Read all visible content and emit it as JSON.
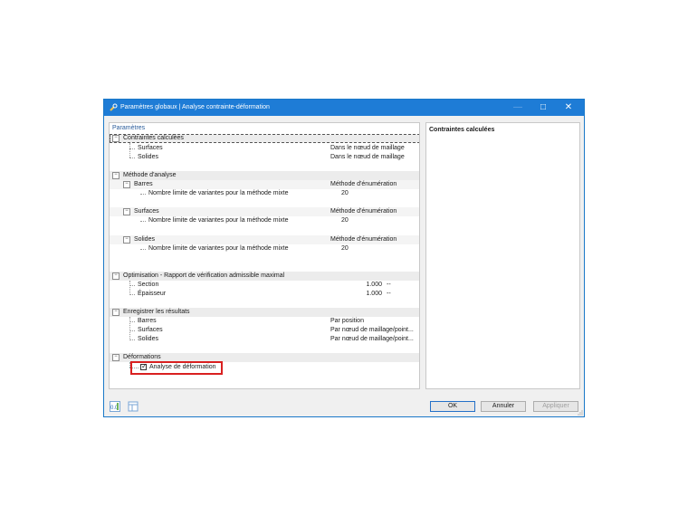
{
  "window": {
    "title": "Paramètres globaux | Analyse contrainte-déformation",
    "minimize": "—",
    "maximize": "□",
    "close": "✕"
  },
  "left_panel": {
    "title": "Paramètres",
    "rows": [
      {
        "label": "Contraintes calculées",
        "value": ""
      },
      {
        "label": "Surfaces",
        "value": "Dans le nœud de maillage"
      },
      {
        "label": "Solides",
        "value": "Dans le nœud de maillage"
      },
      {
        "label": "Méthode d'analyse",
        "value": ""
      },
      {
        "label": "Barres",
        "value": "Méthode d'énumération"
      },
      {
        "label": "Nombre limite de variantes pour la méthode mixte",
        "value": "20"
      },
      {
        "label": "Surfaces",
        "value": "Méthode d'énumération"
      },
      {
        "label": "Nombre limite de variantes pour la méthode mixte",
        "value": "20"
      },
      {
        "label": "Solides",
        "value": "Méthode d'énumération"
      },
      {
        "label": "Nombre limite de variantes pour la méthode mixte",
        "value": "20"
      },
      {
        "label": "Optimisation - Rapport de vérification admissible maximal",
        "value": ""
      },
      {
        "label": "Section",
        "value": "1.000",
        "unit": "--"
      },
      {
        "label": "Épaisseur",
        "value": "1.000",
        "unit": "--"
      },
      {
        "label": "Enregistrer les résultats",
        "value": ""
      },
      {
        "label": "Barres",
        "value": "Par position"
      },
      {
        "label": "Surfaces",
        "value": "Par nœud de maillage/point..."
      },
      {
        "label": "Solides",
        "value": "Par nœud de maillage/point..."
      },
      {
        "label": "Déformations",
        "value": ""
      },
      {
        "label": "Analyse de déformation",
        "checked": true
      }
    ],
    "collapse_glyph": "−",
    "check_glyph": "✓"
  },
  "right_panel": {
    "title": "Contraintes calculées"
  },
  "footer": {
    "icons": [
      "units-icon",
      "dialog-table-icon"
    ],
    "ok": "OK",
    "cancel": "Annuler",
    "apply": "Appliquer"
  },
  "colors": {
    "titlebar": "#1e7cd6",
    "highlight": "#d92020"
  }
}
